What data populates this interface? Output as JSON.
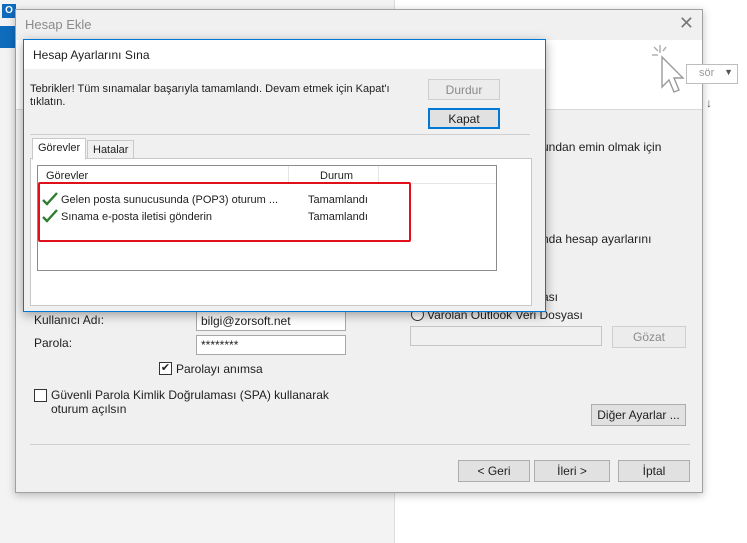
{
  "background": {
    "app_icon_letter": "O",
    "accent_color": "#0f6cbd"
  },
  "outer_dialog": {
    "title": "Hesap Ekle",
    "close_symbol": "✕",
    "combo_text": "sör",
    "right_text_1": "undan emin olmak için",
    "right_text_2": "nda hesap ayarlarını",
    "right_text_3": "ası",
    "existing_file_radio_label": "Varolan Outlook Veri Dosyası",
    "browse_button": "Gözat",
    "username_label": "Kullanıcı Adı:",
    "username_value": "bilgi@zorsoft.net",
    "password_label": "Parola:",
    "password_value": "********",
    "remember_password_label": "Parolayı anımsa",
    "spa_label": "Güvenli Parola Kimlik Doğrulaması (SPA) kullanarak oturum açılsın",
    "more_settings_button": "Diğer Ayarlar ...",
    "back_button": "< Geri",
    "next_button": "İleri >",
    "cancel_button": "İptal"
  },
  "inner_dialog": {
    "title": "Hesap Ayarlarını Sına",
    "message": "Tebrikler! Tüm sınamalar başarıyla tamamlandı. Devam etmek için Kapat'ı tıklatın.",
    "stop_button": "Durdur",
    "close_button": "Kapat",
    "tabs": [
      "Görevler",
      "Hatalar"
    ],
    "columns": {
      "task": "Görevler",
      "status": "Durum"
    },
    "rows": [
      {
        "task": "Gelen posta sunucusunda (POP3) oturum ...",
        "status": "Tamamlandı"
      },
      {
        "task": "Sınama e-posta iletisi gönderin",
        "status": "Tamamlandı"
      }
    ]
  },
  "colors": {
    "highlight": "#e0101b",
    "check": "#2e7d32",
    "focus": "#0078d7"
  }
}
